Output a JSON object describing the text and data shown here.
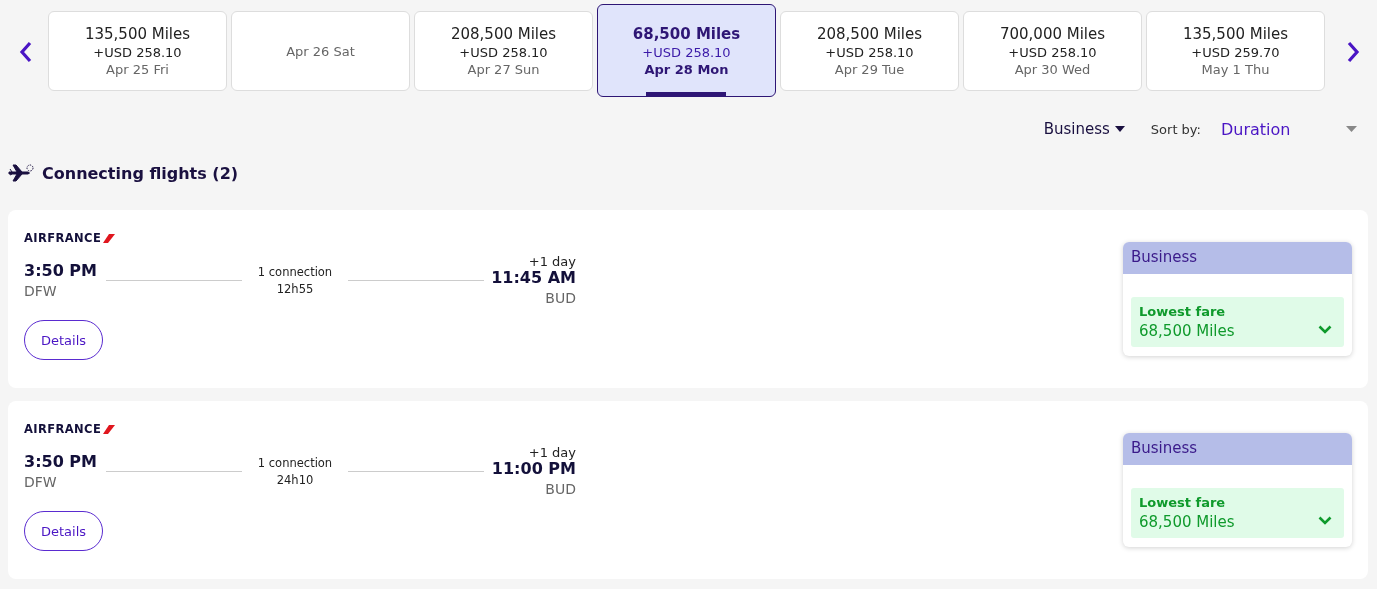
{
  "dates": [
    {
      "miles": "135,500 Miles",
      "surcharge": "+USD 258.10",
      "date": "Apr 25 Fri",
      "selected": false
    },
    {
      "date": "Apr 26 Sat",
      "selected": false
    },
    {
      "miles": "208,500 Miles",
      "surcharge": "+USD 258.10",
      "date": "Apr 27 Sun",
      "selected": false
    },
    {
      "miles": "68,500 Miles",
      "surcharge": "+USD 258.10",
      "date": "Apr 28 Mon",
      "selected": true
    },
    {
      "miles": "208,500 Miles",
      "surcharge": "+USD 258.10",
      "date": "Apr 29 Tue",
      "selected": false
    },
    {
      "miles": "700,000 Miles",
      "surcharge": "+USD 258.10",
      "date": "Apr 30 Wed",
      "selected": false
    },
    {
      "miles": "135,500 Miles",
      "surcharge": "+USD 259.70",
      "date": "May 1 Thu",
      "selected": false
    }
  ],
  "cabin_filter": "Business",
  "sort_label": "Sort by:",
  "sort_value": "Duration",
  "section_title": "Connecting flights (2)",
  "flights": [
    {
      "airline": "AIRFRANCE",
      "depart_time": "3:50 PM",
      "depart_airport": "DFW",
      "connections": "1 connection",
      "duration": "12h55",
      "day_offset": "+1 day",
      "arrive_time": "11:45 AM",
      "arrive_airport": "BUD",
      "details": "Details",
      "cabin": "Business",
      "fare_label": "Lowest fare",
      "fare_price": "68,500 Miles"
    },
    {
      "airline": "AIRFRANCE",
      "depart_time": "3:50 PM",
      "depart_airport": "DFW",
      "connections": "1 connection",
      "duration": "24h10",
      "day_offset": "+1 day",
      "arrive_time": "11:00 PM",
      "arrive_airport": "BUD",
      "details": "Details",
      "cabin": "Business",
      "fare_label": "Lowest fare",
      "fare_price": "68,500 Miles"
    }
  ]
}
